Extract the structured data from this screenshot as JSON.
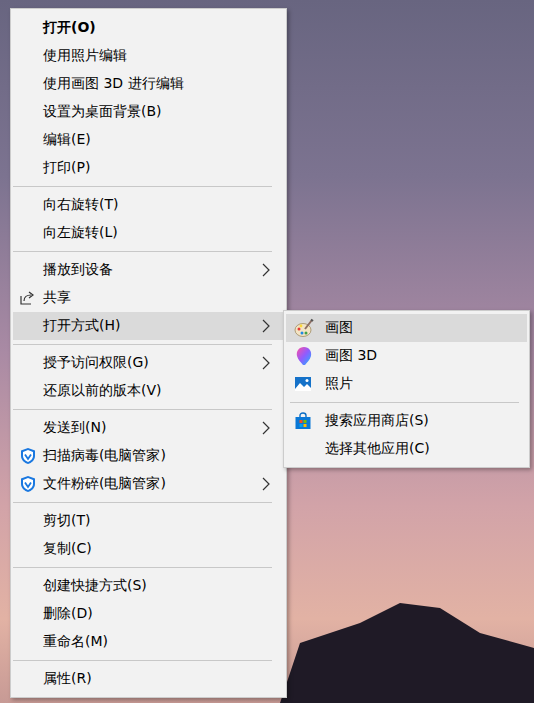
{
  "main_menu": {
    "items": [
      {
        "kind": "item",
        "label": "打开(O)",
        "bold": true,
        "submenu": false,
        "selected": false
      },
      {
        "kind": "item",
        "label": "使用照片编辑",
        "bold": false,
        "submenu": false,
        "selected": false
      },
      {
        "kind": "item",
        "label": "使用画图 3D 进行编辑",
        "bold": false,
        "submenu": false,
        "selected": false
      },
      {
        "kind": "item",
        "label": "设置为桌面背景(B)",
        "bold": false,
        "submenu": false,
        "selected": false
      },
      {
        "kind": "item",
        "label": "编辑(E)",
        "bold": false,
        "submenu": false,
        "selected": false
      },
      {
        "kind": "item",
        "label": "打印(P)",
        "bold": false,
        "submenu": false,
        "selected": false
      },
      {
        "kind": "separator"
      },
      {
        "kind": "item",
        "label": "向右旋转(T)",
        "bold": false,
        "submenu": false,
        "selected": false
      },
      {
        "kind": "item",
        "label": "向左旋转(L)",
        "bold": false,
        "submenu": false,
        "selected": false
      },
      {
        "kind": "separator"
      },
      {
        "kind": "item",
        "label": "播放到设备",
        "bold": false,
        "submenu": true,
        "selected": false
      },
      {
        "kind": "item",
        "label": "共享",
        "bold": false,
        "submenu": false,
        "selected": false
      },
      {
        "kind": "item",
        "label": "打开方式(H)",
        "bold": false,
        "submenu": true,
        "selected": true
      },
      {
        "kind": "separator"
      },
      {
        "kind": "item",
        "label": "授予访问权限(G)",
        "bold": false,
        "submenu": true,
        "selected": false
      },
      {
        "kind": "item",
        "label": "还原以前的版本(V)",
        "bold": false,
        "submenu": false,
        "selected": false
      },
      {
        "kind": "separator"
      },
      {
        "kind": "item",
        "label": "发送到(N)",
        "bold": false,
        "submenu": true,
        "selected": false
      },
      {
        "kind": "item",
        "label": "扫描病毒(电脑管家)",
        "bold": false,
        "submenu": false,
        "selected": false
      },
      {
        "kind": "item",
        "label": "文件粉碎(电脑管家)",
        "bold": false,
        "submenu": true,
        "selected": false
      },
      {
        "kind": "separator"
      },
      {
        "kind": "item",
        "label": "剪切(T)",
        "bold": false,
        "submenu": false,
        "selected": false
      },
      {
        "kind": "item",
        "label": "复制(C)",
        "bold": false,
        "submenu": false,
        "selected": false
      },
      {
        "kind": "separator"
      },
      {
        "kind": "item",
        "label": "创建快捷方式(S)",
        "bold": false,
        "submenu": false,
        "selected": false
      },
      {
        "kind": "item",
        "label": "删除(D)",
        "bold": false,
        "submenu": false,
        "selected": false
      },
      {
        "kind": "item",
        "label": "重命名(M)",
        "bold": false,
        "submenu": false,
        "selected": false
      },
      {
        "kind": "separator"
      },
      {
        "kind": "item",
        "label": "属性(R)",
        "bold": false,
        "submenu": false,
        "selected": false
      }
    ]
  },
  "open_with_menu": {
    "items": [
      {
        "kind": "item",
        "label": "画图",
        "selected": true
      },
      {
        "kind": "item",
        "label": "画图 3D",
        "selected": false
      },
      {
        "kind": "item",
        "label": "照片",
        "selected": false
      },
      {
        "kind": "separator"
      },
      {
        "kind": "item",
        "label": "搜索应用商店(S)",
        "selected": false
      },
      {
        "kind": "item",
        "label": "选择其他应用(C)",
        "selected": false
      }
    ]
  }
}
